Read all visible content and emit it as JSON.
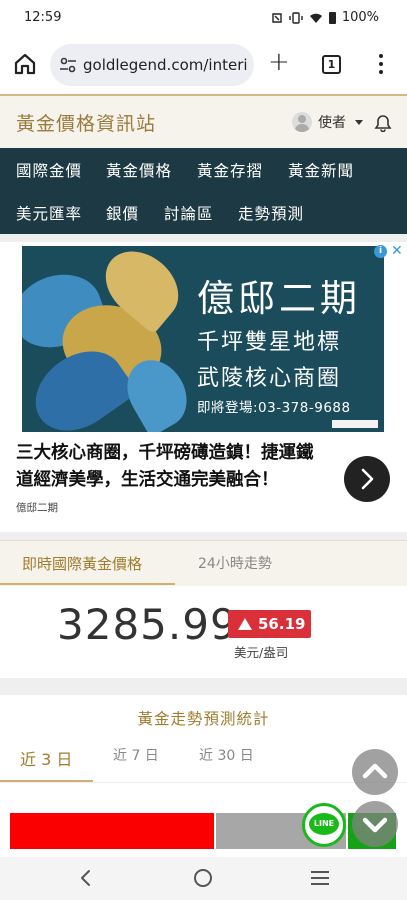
{
  "status_bar": {
    "time": "12:59",
    "battery": "100%"
  },
  "browser": {
    "url": "goldlegend.com/interi",
    "tab_count": "1"
  },
  "site": {
    "title": "黃金價格資訊站",
    "user_name": "使者"
  },
  "nav": {
    "row1": [
      "國際金價",
      "黃金價格",
      "黃金存摺",
      "黃金新聞"
    ],
    "row2": [
      "美元匯率",
      "銀價",
      "討論區",
      "走勢預測"
    ]
  },
  "ad": {
    "headline": "億邸二期",
    "line2": "千坪雙星地標",
    "line3": "武陵核心商圈",
    "phone_line": "即將登場:03-378-9688",
    "text": "三大核心商圈，千坪磅礡造鎮！捷運鐵道經濟美學，生活交通完美融合！",
    "source": "億邸二期"
  },
  "price": {
    "tab_active": "即時國際黃金價格",
    "tab_inactive": "24小時走勢",
    "value": "3285.99",
    "change": "56.19",
    "unit": "美元/盎司"
  },
  "forecast": {
    "title": "黃金走勢預測統計",
    "tabs": [
      "近 3 日",
      "近 7 日",
      "近 30 日"
    ]
  },
  "line_label": "LINE",
  "colors": {
    "nav_bg": "#1d3a44",
    "gold": "#a07d2e",
    "up_red": "#d9303a"
  }
}
